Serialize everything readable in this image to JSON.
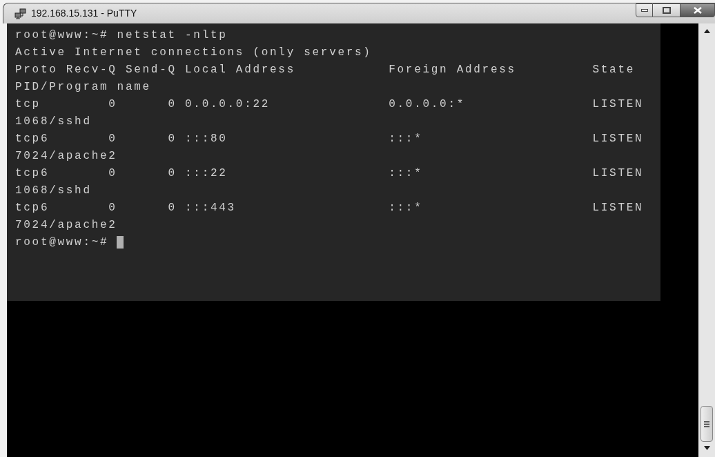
{
  "window": {
    "title": "192.168.15.131 - PuTTY"
  },
  "terminal": {
    "lines": [
      "root@www:~# netstat -nltp",
      "Active Internet connections (only servers)",
      "Proto Recv-Q Send-Q Local Address           Foreign Address         State",
      "PID/Program name",
      "tcp        0      0 0.0.0.0:22              0.0.0.0:*               LISTEN",
      "1068/sshd",
      "tcp6       0      0 :::80                   :::*                    LISTEN",
      "7024/apache2",
      "tcp6       0      0 :::22                   :::*                    LISTEN",
      "1068/sshd",
      "tcp6       0      0 :::443                  :::*                    LISTEN",
      "7024/apache2",
      "root@www:~#"
    ],
    "cursor": true
  }
}
